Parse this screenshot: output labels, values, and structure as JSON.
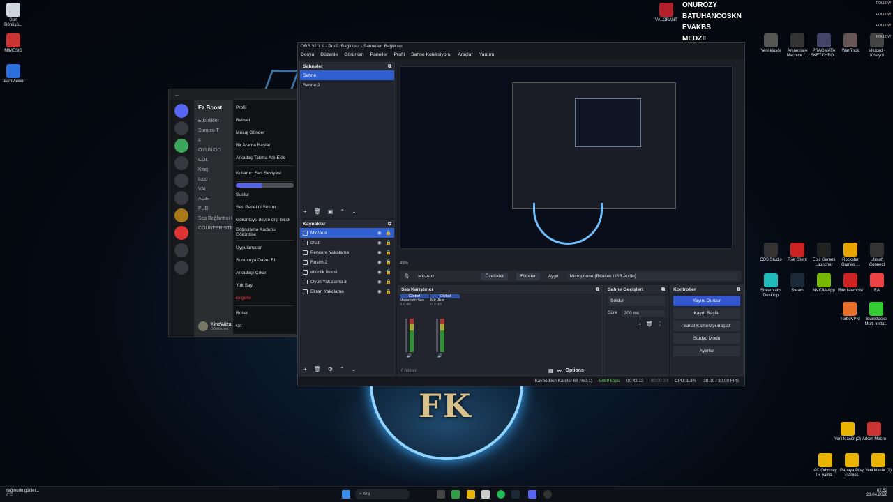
{
  "desktop": {
    "left_icons": [
      {
        "label": "Geri Dönüşü...",
        "color": "#cfd6e0"
      },
      {
        "label": "MIMESIS",
        "color": "#c33"
      },
      {
        "label": "TeamViewer",
        "color": "#2a6fdb"
      }
    ],
    "top_right_icon": {
      "label": "VALORANT",
      "color": "#b3202a"
    },
    "right_icons_row1": [
      {
        "label": "Yeni klasör",
        "color": "#555"
      },
      {
        "label": "Amnesia A Machine f...",
        "color": "#333"
      },
      {
        "label": "PRAGMATA SKETCHBO...",
        "color": "#446"
      },
      {
        "label": "WarRock",
        "color": "#655"
      },
      {
        "label": "silkroad - Kısayol",
        "color": "#444"
      }
    ],
    "right_icons_row2": [
      {
        "label": "OBS Studio",
        "color": "#333"
      },
      {
        "label": "Riot Client",
        "color": "#c22"
      },
      {
        "label": "Epic Games Launcher",
        "color": "#222"
      },
      {
        "label": "Rockstar Games ...",
        "color": "#e8a400"
      },
      {
        "label": "Ubisoft Connect",
        "color": "#333"
      }
    ],
    "right_icons_row3": [
      {
        "label": "Streamlabs Desktop",
        "color": "#2bb"
      },
      {
        "label": "Steam",
        "color": "#1b2838"
      },
      {
        "label": "NVIDIA App",
        "color": "#76b900"
      },
      {
        "label": "Riot İstemcisi",
        "color": "#c22"
      },
      {
        "label": "EA",
        "color": "#e44"
      }
    ],
    "right_icons_row4": [
      {
        "label": "TurboVPN",
        "color": "#e8702a"
      },
      {
        "label": "BlueStacks Multi-Insta...",
        "color": "#3c3"
      }
    ],
    "right_icons_bottom": [
      {
        "label": "Yeni klasör (2)",
        "color": "#e8b400"
      },
      {
        "label": "Arken Macro",
        "color": "#c33"
      },
      {
        "label": "AC Odyssey TR yama...",
        "color": "#e8b400"
      },
      {
        "label": "Papaya Play Games",
        "color": "#e8b400"
      },
      {
        "label": "Yeni klasör (3)",
        "color": "#e8b400"
      }
    ],
    "emblem_text": "FK"
  },
  "follow_overlay": {
    "rows": [
      {
        "name": "ONURÖZY",
        "tag": "FOLLOW"
      },
      {
        "name": "BATUHANCOSKN",
        "tag": "FOLLOW"
      },
      {
        "name": "EVAKBS",
        "tag": "FOLLOW"
      },
      {
        "name": "MEDZII",
        "tag": "FOLLOW"
      }
    ]
  },
  "discord": {
    "server_name": "Ez Boost",
    "channels": [
      "Etkinlikler",
      "Sunucu T",
      "# ",
      "OYUN OD",
      "COL",
      "Kinq",
      "tuco",
      "VAL",
      "AGE",
      "PUB",
      "Ses Bağlantısı Kur",
      "COUNTER STRIKE"
    ],
    "user": {
      "name": "KinqWizarD",
      "status": "Görünmez"
    },
    "context_menu": [
      "Profil",
      "Bahset",
      "Mesaj Gönder",
      "Bir Arama Başlat",
      "Arkadaş Takma Adı Ekle",
      "Kullanıcı Ses Seviyesi",
      "Sustur",
      "Ses Panelini Sustur",
      "Görüntüyü devre dışı bırak",
      "Doğrulama Kodunu Görüntüle",
      "Uygulamalar",
      "Sunucuya Davet Et",
      "Arkadaşı Çıkar",
      "Yok Say",
      "Engelle",
      "Roller",
      "Git"
    ]
  },
  "obs": {
    "title": "OBS 32.1.1 - Profil: Bağlıksız - Sahneler: Bağlıksız",
    "menu": [
      "Dosya",
      "Düzenle",
      "Görünüm",
      "Paneller",
      "Profil",
      "Sahne Koleksiyonu",
      "Araçlar",
      "Yardım"
    ],
    "scenes_title": "Sahneler",
    "scenes": [
      "Sahne",
      "Sahne 2"
    ],
    "sources_title": "Kaynaklar",
    "sources": [
      "Mic/Aux",
      "chat",
      "Pencere Yakalama",
      "Resim 2",
      "etkinlik listesi",
      "Oyun Yakalama 3",
      "Ekran Yakalama"
    ],
    "zoom": "49%",
    "source_bar": {
      "name": "Mic/Aux",
      "properties": "Özellikler",
      "filters": "Filtreler",
      "device_label": "Aygıt",
      "device": "Microphone (Realtek USB Audio)"
    },
    "mixer_title": "Ses Karıştırıcı",
    "mixer_channels": [
      {
        "tag": "Global",
        "name": "Masaüstü Ses",
        "db": "0.0 dB"
      },
      {
        "tag": "Global",
        "name": "Mic/Aux",
        "db": "0.0 dB"
      }
    ],
    "mixer_hidden": "0 hidden",
    "options_label": "Options",
    "transitions_title": "Sahne Geçişleri",
    "transition": "Soldur",
    "duration_label": "Süre",
    "duration": "300 ms",
    "controls_title": "Kontroller",
    "controls": [
      "Yayını Durdur",
      "Kaydı Başlat",
      "Sanal Kamerayı Başlat",
      "Stüdyo Modu",
      "Ayarlar"
    ],
    "status": {
      "dropped": "Kaybedilen Kareler 68 (%0.1)",
      "bitrate": "5089 kbps",
      "live_time": "00:42:13",
      "rec_time": "00:00:00",
      "cpu": "CPU: 1.3%",
      "fps": "30.00 / 30.00 FPS"
    }
  },
  "taskbar": {
    "weather": "Yağmurlu günler...",
    "temp": "2°C",
    "search": "Ara",
    "time": "02:52",
    "date": "28.04.2026"
  }
}
